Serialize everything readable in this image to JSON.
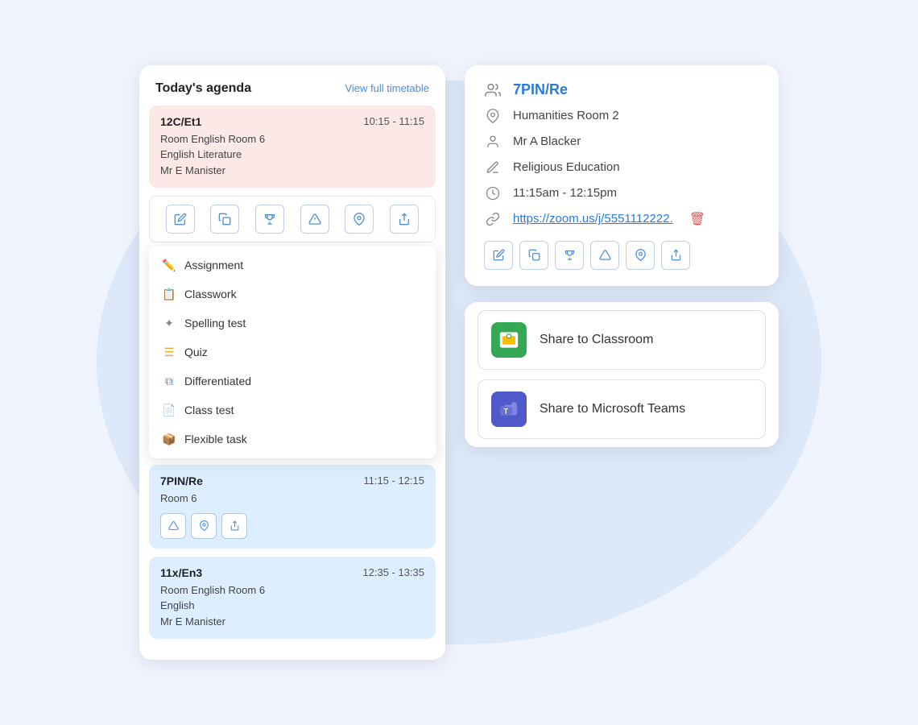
{
  "background": "#dde8f8",
  "left_panel": {
    "title": "Today's agenda",
    "view_full_label": "View full timetable",
    "lessons": [
      {
        "class": "12C/Et1",
        "time": "10:15 - 11:15",
        "room": "Room English Room 6",
        "subject": "English Literature",
        "teacher": "Mr E Manister",
        "color": "pink"
      },
      {
        "class": "7PIN/Re",
        "time": "11:15 - 12:15",
        "room": "Room 6",
        "subject": "",
        "teacher": "",
        "color": "blue"
      },
      {
        "class": "11x/En3",
        "time": "12:35 - 13:35",
        "room": "Room English Room 6",
        "subject": "English",
        "teacher": "Mr E Manister",
        "color": "blue"
      }
    ],
    "action_icons": [
      "edit",
      "copy",
      "trophy",
      "alert",
      "pin",
      "share"
    ],
    "dropdown": {
      "items": [
        {
          "label": "Assignment",
          "icon": "✏️",
          "color": "blue"
        },
        {
          "label": "Classwork",
          "icon": "📋",
          "color": "red"
        },
        {
          "label": "Spelling test",
          "icon": "🔤",
          "color": "gray"
        },
        {
          "label": "Quiz",
          "icon": "≡",
          "color": "orange"
        },
        {
          "label": "Differentiated",
          "icon": "⧉",
          "color": "blue"
        },
        {
          "label": "Class test",
          "icon": "📄",
          "color": "gray"
        },
        {
          "label": "Flexible task",
          "icon": "📦",
          "color": "red"
        }
      ]
    }
  },
  "right_panel": {
    "class_name": "7PIN/Re",
    "room": "Humanities Room 2",
    "teacher": "Mr A Blacker",
    "subject": "Religious Education",
    "time": "11:15am - 12:15pm",
    "zoom_link": "https://zoom.us/j/5551112222.",
    "action_icons": [
      "edit",
      "copy",
      "trophy",
      "alert",
      "pin",
      "share"
    ],
    "share_buttons": [
      {
        "label": "Share to Classroom",
        "platform": "google-classroom"
      },
      {
        "label": "Share to Microsoft Teams",
        "platform": "microsoft-teams"
      }
    ]
  }
}
